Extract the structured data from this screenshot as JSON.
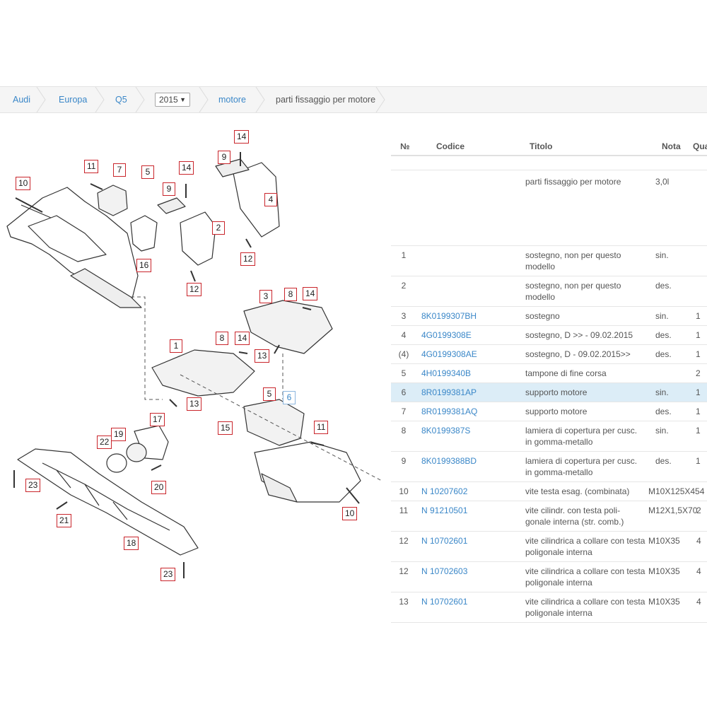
{
  "breadcrumb": {
    "items": [
      "Audi",
      "Europa",
      "Q5"
    ],
    "year": "2015",
    "section": "motore",
    "current": "parti fissaggio per motore"
  },
  "diagram": {
    "callouts": [
      "10",
      "11",
      "7",
      "5",
      "14",
      "9",
      "14",
      "9",
      "4",
      "2",
      "12",
      "12",
      "16",
      "3",
      "8",
      "14",
      "1",
      "8",
      "14",
      "13",
      "13",
      "5",
      "6",
      "15",
      "11",
      "17",
      "19",
      "22",
      "20",
      "23",
      "21",
      "18",
      "23",
      "10"
    ],
    "active_callout": "6"
  },
  "table": {
    "headers": {
      "num": "№",
      "code": "Codice",
      "title": "Titolo",
      "note": "Nota",
      "qty": "Qua"
    },
    "rows": [
      {
        "num": "",
        "code": "",
        "title": "parti fissaggio per motore",
        "note": "3,0l",
        "qty": ""
      },
      {
        "num": "1",
        "code": "",
        "title": "sostegno, non per questo modello",
        "note": "sin.",
        "qty": ""
      },
      {
        "num": "2",
        "code": "",
        "title": "sostegno, non per questo modello",
        "note": "des.",
        "qty": ""
      },
      {
        "num": "3",
        "code": "8K0199307BH",
        "title": "sostegno",
        "note": "sin.",
        "qty": "1"
      },
      {
        "num": "4",
        "code": "4G0199308E",
        "title": "sostegno, D >> - 09.02.2015",
        "note": "des.",
        "qty": "1"
      },
      {
        "num": "(4)",
        "code": "4G0199308AE",
        "title": "sostegno, D - 09.02.2015>>",
        "note": "des.",
        "qty": "1"
      },
      {
        "num": "5",
        "code": "4H0199340B",
        "title": "tampone di fine corsa",
        "note": "",
        "qty": "2"
      },
      {
        "num": "6",
        "code": "8R0199381AP",
        "title": "supporto motore",
        "note": "sin.",
        "qty": "1"
      },
      {
        "num": "7",
        "code": "8R0199381AQ",
        "title": "supporto motore",
        "note": "des.",
        "qty": "1"
      },
      {
        "num": "8",
        "code": "8K0199387S",
        "title": "lamiera di copertura per cusc. in gomma-metallo",
        "note": "sin.",
        "qty": "1"
      },
      {
        "num": "9",
        "code": "8K0199388BD",
        "title": "lamiera di copertura per cusc. in gomma-metallo",
        "note": "des.",
        "qty": "1"
      },
      {
        "num": "10",
        "code": "N 10207602",
        "title": "vite testa esag. (combinata)",
        "note": "M10X125X454",
        "qty": ""
      },
      {
        "num": "11",
        "code": "N 91210501",
        "title": "vite cilindr. con testa poli- gonale interna (str. comb.)",
        "note": "M12X1,5X70",
        "qty": "2"
      },
      {
        "num": "12",
        "code": "N 10702601",
        "title": "vite cilindrica a collare con testa poligonale interna",
        "note": "M10X35",
        "qty": "4"
      },
      {
        "num": "12",
        "code": "N 10702603",
        "title": "vite cilindrica a collare con testa poligonale interna",
        "note": "M10X35",
        "qty": "4"
      },
      {
        "num": "13",
        "code": "N 10702601",
        "title": "vite cilindrica a collare con testa poligonale interna",
        "note": "M10X35",
        "qty": "4"
      }
    ]
  },
  "colors": {
    "link": "#3a87c8",
    "callout_border": "#c9252b",
    "selected_row": "#dcedf7"
  }
}
